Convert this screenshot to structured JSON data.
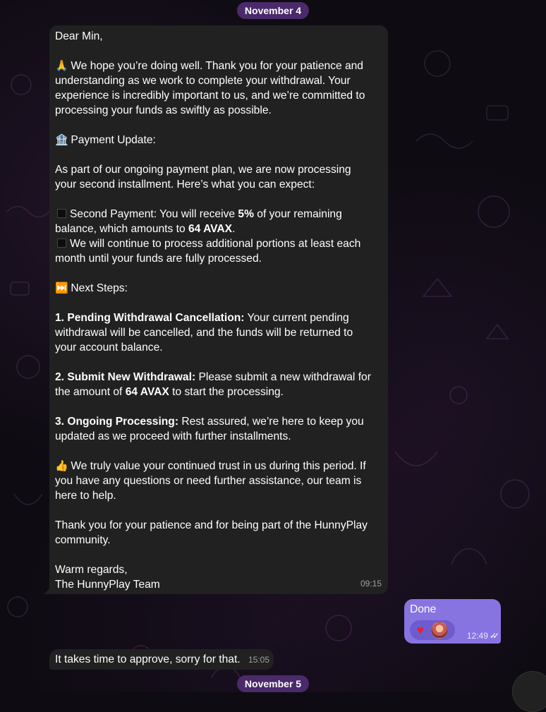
{
  "dates": {
    "first": "November 4",
    "second": "November 5"
  },
  "incoming_message": {
    "lines": [
      {
        "parts": [
          {
            "t": "Dear Min,"
          }
        ]
      },
      {
        "parts": [
          {
            "t": ""
          }
        ]
      },
      {
        "emoji": "🙏",
        "parts": [
          {
            "t": " We hope you’re doing well. Thank you for your patience and"
          }
        ]
      },
      {
        "parts": [
          {
            "t": "understanding as we work to complete your withdrawal. Your"
          }
        ]
      },
      {
        "parts": [
          {
            "t": "experience is incredibly important to us, and we’re committed to"
          }
        ]
      },
      {
        "parts": [
          {
            "t": "processing your funds as swiftly as possible."
          }
        ]
      },
      {
        "parts": [
          {
            "t": ""
          }
        ]
      },
      {
        "emoji": "🏦",
        "parts": [
          {
            "t": " Payment Update:"
          }
        ]
      },
      {
        "parts": [
          {
            "t": ""
          }
        ]
      },
      {
        "parts": [
          {
            "t": "As part of our ongoing payment plan, we are now processing"
          }
        ]
      },
      {
        "parts": [
          {
            "t": "your second installment. Here’s what you can expect:"
          }
        ]
      },
      {
        "parts": [
          {
            "t": ""
          }
        ]
      },
      {
        "square": true,
        "parts": [
          {
            "t": "Second Payment: You will receive "
          },
          {
            "t": "5%",
            "b": true
          },
          {
            "t": " of your remaining"
          }
        ]
      },
      {
        "parts": [
          {
            "t": "balance, which amounts to "
          },
          {
            "t": "64 AVAX",
            "b": true
          },
          {
            "t": "."
          }
        ]
      },
      {
        "square": true,
        "parts": [
          {
            "t": "We will continue to process additional portions at least each"
          }
        ]
      },
      {
        "parts": [
          {
            "t": "month until your funds are fully processed."
          }
        ]
      },
      {
        "parts": [
          {
            "t": ""
          }
        ]
      },
      {
        "emoji": "⏭️",
        "parts": [
          {
            "t": " Next Steps:"
          }
        ]
      },
      {
        "parts": [
          {
            "t": ""
          }
        ]
      },
      {
        "parts": [
          {
            "t": "1. Pending Withdrawal Cancellation:",
            "b": true
          },
          {
            "t": " Your current pending"
          }
        ]
      },
      {
        "parts": [
          {
            "t": "withdrawal will be cancelled, and the funds will be returned to"
          }
        ]
      },
      {
        "parts": [
          {
            "t": "your account balance."
          }
        ]
      },
      {
        "parts": [
          {
            "t": ""
          }
        ]
      },
      {
        "parts": [
          {
            "t": "2. Submit New Withdrawal:",
            "b": true
          },
          {
            "t": " Please submit a new withdrawal for"
          }
        ]
      },
      {
        "parts": [
          {
            "t": "the amount of "
          },
          {
            "t": "64 AVAX",
            "b": true
          },
          {
            "t": " to start the processing."
          }
        ]
      },
      {
        "parts": [
          {
            "t": ""
          }
        ]
      },
      {
        "parts": [
          {
            "t": "3. Ongoing Processing:",
            "b": true
          },
          {
            "t": " Rest assured, we’re here to keep you"
          }
        ]
      },
      {
        "parts": [
          {
            "t": "updated as we proceed with further installments."
          }
        ]
      },
      {
        "parts": [
          {
            "t": ""
          }
        ]
      },
      {
        "emoji": "👍",
        "parts": [
          {
            "t": " We truly value your continued trust in us during this period. If"
          }
        ]
      },
      {
        "parts": [
          {
            "t": "you have any questions or need further assistance, our team is"
          }
        ]
      },
      {
        "parts": [
          {
            "t": "here to help."
          }
        ]
      },
      {
        "parts": [
          {
            "t": ""
          }
        ]
      },
      {
        "parts": [
          {
            "t": "Thank you for your patience and for being part of the HunnyPlay"
          }
        ]
      },
      {
        "parts": [
          {
            "t": "community."
          }
        ]
      },
      {
        "parts": [
          {
            "t": ""
          }
        ]
      },
      {
        "parts": [
          {
            "t": "Warm regards,"
          }
        ]
      },
      {
        "parts": [
          {
            "t": "The HunnyPlay Team"
          }
        ]
      }
    ],
    "time": "09:15"
  },
  "outgoing_message": {
    "text": "Done",
    "time": "12:49",
    "reaction_icon": "heart-icon",
    "status_icon": "double-check-icon",
    "colors": {
      "bubble": "#8774e1",
      "heart": "#e0242c"
    }
  },
  "incoming_message_2": {
    "text": "It takes time to approve, sorry for that.",
    "time": "15:05"
  },
  "colors": {
    "background": "#0e0b12",
    "incoming_bubble": "#212121",
    "date_pill": "#4a2a6a"
  }
}
